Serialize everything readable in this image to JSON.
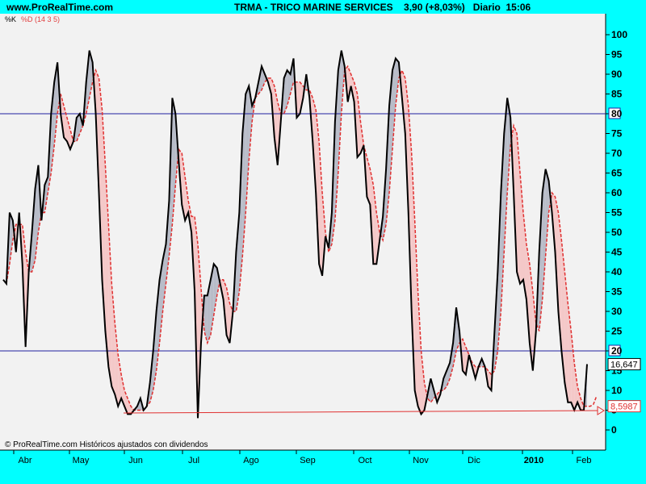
{
  "header": {
    "site": "www.ProRealTime.com",
    "symbol": "TRMA",
    "company": "TRICO MARINE SERVICES",
    "price": "3,90 (+8,03%)",
    "period": "Diario",
    "time": "15:06"
  },
  "indicator": {
    "k_label": "%K",
    "d_label": "%D (14 3 5)"
  },
  "copyright": "© ProRealTime.com Históricos ajustados con dividendos",
  "colors": {
    "background": "#00ffff",
    "plot": "#f2f2f2",
    "k_line": "#000000",
    "d_line": "#e03030",
    "up_fill": "#b8bcc8",
    "down_fill": "#f4c8c8",
    "level_line": "#2020a0"
  },
  "chart_data": {
    "type": "line",
    "title": "TRMA - TRICO MARINE SERVICES",
    "x_tick_labels": [
      "Abr",
      "May",
      "Jun",
      "Jul",
      "Ago",
      "Sep",
      "Oct",
      "Nov",
      "Dic",
      "2010",
      "Feb"
    ],
    "ylim": [
      -5,
      103
    ],
    "y_ticks": [
      0,
      5,
      10,
      15,
      20,
      25,
      30,
      35,
      40,
      45,
      50,
      55,
      60,
      65,
      70,
      75,
      80,
      85,
      90,
      95,
      100
    ],
    "levels": [
      80,
      20
    ],
    "last_values": {
      "K": "16,647",
      "D": "8,5987"
    },
    "series": [
      {
        "name": "%K",
        "values": [
          38,
          37,
          55,
          53,
          45,
          55,
          42,
          21,
          40,
          50,
          61,
          67,
          53,
          62,
          64,
          80,
          88,
          93,
          80,
          74,
          73,
          71,
          73,
          79,
          80,
          77,
          88,
          96,
          93,
          80,
          60,
          38,
          25,
          16,
          11,
          9,
          6,
          8,
          6,
          4,
          4,
          5,
          6,
          8,
          5,
          6,
          12,
          20,
          30,
          38,
          43,
          47,
          58,
          84,
          80,
          68,
          57,
          53,
          55,
          50,
          35,
          3,
          22,
          34,
          34,
          38,
          42,
          41,
          37,
          33,
          24,
          22,
          30,
          45,
          55,
          75,
          85,
          87,
          82,
          84,
          88,
          92,
          90,
          88,
          85,
          74,
          67,
          78,
          89,
          91,
          90,
          94,
          79,
          80,
          84,
          90,
          84,
          73,
          60,
          42,
          39,
          49,
          46,
          55,
          78,
          91,
          96,
          92,
          83,
          87,
          83,
          69,
          70,
          72,
          59,
          57,
          42,
          42,
          48,
          54,
          66,
          82,
          91,
          94,
          93,
          84,
          75,
          55,
          30,
          10,
          6,
          4,
          5,
          9,
          13,
          10,
          7,
          9,
          13,
          15,
          17,
          22,
          31,
          25,
          15,
          14,
          19,
          16,
          13,
          16,
          18,
          16,
          11,
          10,
          25,
          40,
          60,
          75,
          84,
          79,
          60,
          40,
          37,
          38,
          33,
          22,
          15,
          25,
          45,
          60,
          66,
          63,
          55,
          45,
          30,
          20,
          12,
          7,
          7,
          5,
          7,
          5,
          5,
          16.647
        ]
      },
      {
        "name": "%D",
        "values": [
          38,
          37,
          42,
          48,
          52,
          52,
          52,
          45,
          40,
          40,
          43,
          50,
          55,
          55,
          60,
          65,
          72,
          80,
          85,
          82,
          79,
          76,
          73,
          73,
          75,
          77,
          80,
          84,
          88,
          91,
          89,
          81,
          67,
          52,
          37,
          27,
          19,
          14,
          10,
          8,
          6,
          5,
          5,
          5,
          5,
          6,
          7,
          10,
          15,
          22,
          30,
          37,
          44,
          52,
          62,
          71,
          70,
          64,
          58,
          54,
          54,
          47,
          36,
          25,
          22,
          24,
          29,
          34,
          38,
          38,
          36,
          32,
          30,
          30,
          35,
          44,
          55,
          68,
          78,
          84,
          85,
          86,
          88,
          89,
          89,
          87,
          83,
          80,
          80,
          82,
          85,
          88,
          88,
          88,
          87,
          86,
          86,
          84,
          81,
          73,
          60,
          50,
          45,
          47,
          53,
          65,
          80,
          91,
          92,
          90,
          88,
          85,
          78,
          72,
          69,
          66,
          62,
          55,
          50,
          48,
          52,
          60,
          71,
          82,
          89,
          91,
          89,
          82,
          70,
          53,
          35,
          20,
          12,
          8,
          7,
          8,
          9,
          10,
          10,
          11,
          13,
          16,
          20,
          22,
          23,
          21,
          19,
          17,
          16,
          16,
          16,
          16,
          15,
          14,
          15,
          20,
          30,
          45,
          60,
          72,
          77,
          75,
          65,
          55,
          47,
          42,
          35,
          27,
          25,
          33,
          44,
          55,
          60,
          59,
          55,
          48,
          40,
          32,
          25,
          17,
          11,
          8,
          6,
          6,
          6,
          6.5,
          8.5987
        ]
      }
    ]
  }
}
